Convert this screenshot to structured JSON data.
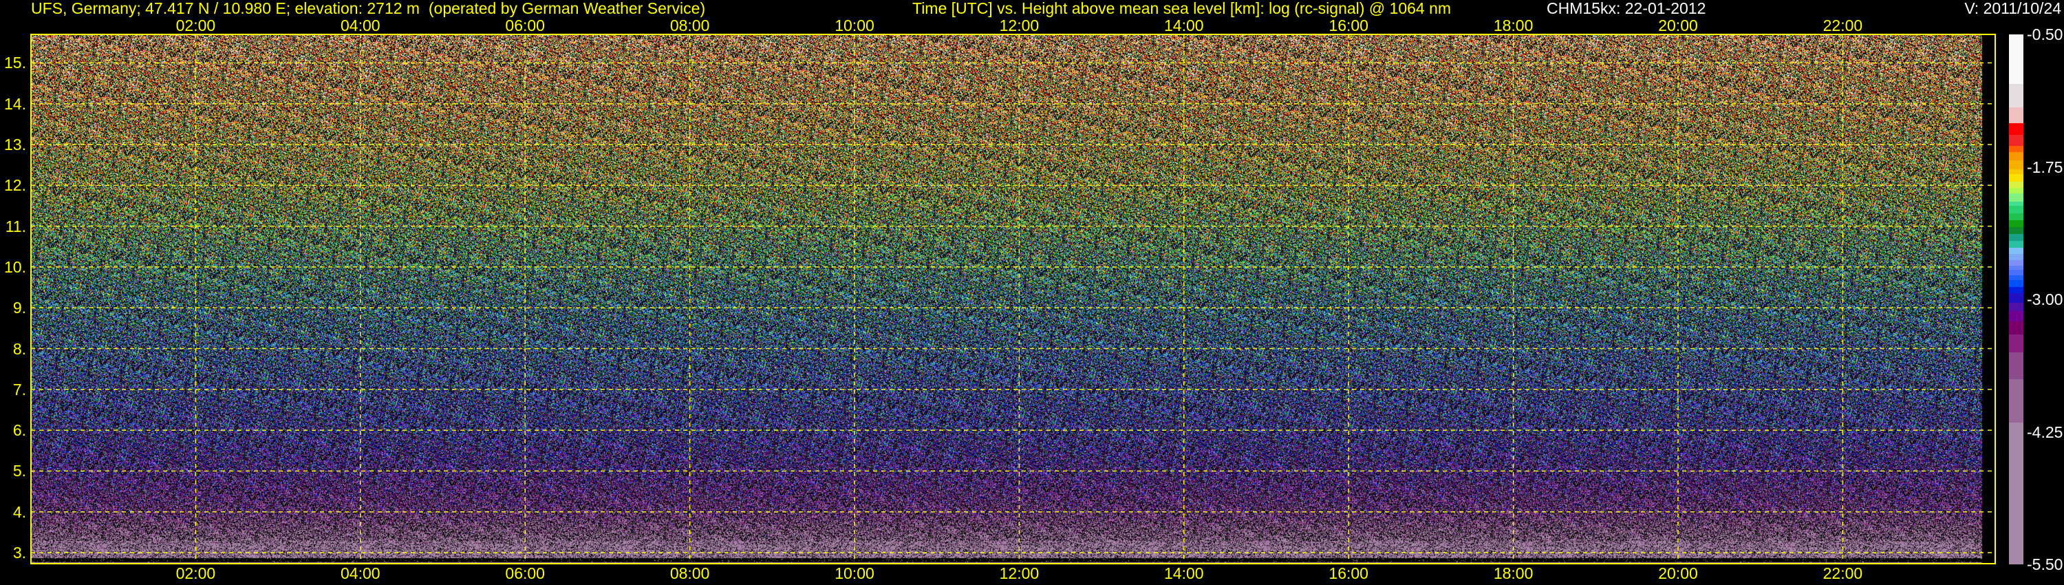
{
  "header": {
    "station": "UFS, Germany; 47.417 N / 10.980 E; elevation: 2712 m  (operated by German Weather Service)",
    "title": "Time [UTC] vs. Height above mean sea level [km]: log (rc-signal) @ 1064 nm",
    "instrument": "CHM15kx: 22-01-2012",
    "version": "V: 2011/10/24"
  },
  "colors": {
    "axis": "#ffff00",
    "background": "#000000",
    "label_secondary": "#ffffff"
  },
  "chart_data": {
    "type": "heatmap",
    "title": "Time [UTC] vs. Height above mean sea level [km]: log (rc-signal) @ 1064 nm",
    "xlabel": "Time [UTC]",
    "ylabel": "Height above mean sea level [km]",
    "xlim_hours": [
      0,
      23.85
    ],
    "ylim_km": [
      2.73,
      15.7
    ],
    "grid": true,
    "x_ticks": [
      "02:00",
      "04:00",
      "06:00",
      "08:00",
      "10:00",
      "12:00",
      "14:00",
      "16:00",
      "18:00",
      "20:00",
      "22:00"
    ],
    "x_tick_hours": [
      2,
      4,
      6,
      8,
      10,
      12,
      14,
      16,
      18,
      20,
      22
    ],
    "y_ticks": [
      "3.",
      "4.",
      "5.",
      "6.",
      "7.",
      "8.",
      "9.",
      "10.",
      "11.",
      "12.",
      "13.",
      "14.",
      "15."
    ],
    "y_tick_km": [
      3,
      4,
      5,
      6,
      7,
      8,
      9,
      10,
      11,
      12,
      13,
      14,
      15
    ],
    "colorbar": {
      "range": [
        -5.5,
        -0.5
      ],
      "tick_labels": [
        "-0.50",
        "-1.75",
        "-3.00",
        "-4.25",
        "-5.50"
      ],
      "tick_values": [
        -0.5,
        -1.75,
        -3.0,
        -4.25,
        -5.5
      ],
      "segments": [
        {
          "from": -0.5,
          "to": -0.97,
          "color": "#f8f8f8"
        },
        {
          "from": -0.97,
          "to": -1.19,
          "color": "#e6dede"
        },
        {
          "from": -1.19,
          "to": -1.34,
          "color": "#f0c0c0"
        },
        {
          "from": -1.34,
          "to": -1.45,
          "color": "#ff0000"
        },
        {
          "from": -1.45,
          "to": -1.55,
          "color": "#f02828"
        },
        {
          "from": -1.55,
          "to": -1.61,
          "color": "#ff6000"
        },
        {
          "from": -1.61,
          "to": -1.69,
          "color": "#f89800"
        },
        {
          "from": -1.69,
          "to": -1.77,
          "color": "#f8b000"
        },
        {
          "from": -1.77,
          "to": -1.82,
          "color": "#f8c800"
        },
        {
          "from": -1.82,
          "to": -1.89,
          "color": "#f8e000"
        },
        {
          "from": -1.89,
          "to": -1.95,
          "color": "#d8f040"
        },
        {
          "from": -1.95,
          "to": -2.0,
          "color": "#b0f850"
        },
        {
          "from": -2.0,
          "to": -2.08,
          "color": "#80f080"
        },
        {
          "from": -2.08,
          "to": -2.12,
          "color": "#40e090"
        },
        {
          "from": -2.12,
          "to": -2.19,
          "color": "#28d070"
        },
        {
          "from": -2.19,
          "to": -2.25,
          "color": "#20c050"
        },
        {
          "from": -2.25,
          "to": -2.32,
          "color": "#10a010"
        },
        {
          "from": -2.32,
          "to": -2.38,
          "color": "#108830"
        },
        {
          "from": -2.38,
          "to": -2.45,
          "color": "#18a088"
        },
        {
          "from": -2.45,
          "to": -2.51,
          "color": "#28c0a0"
        },
        {
          "from": -2.51,
          "to": -2.57,
          "color": "#80c0f8"
        },
        {
          "from": -2.57,
          "to": -2.63,
          "color": "#80a8f8"
        },
        {
          "from": -2.63,
          "to": -2.68,
          "color": "#8090f8"
        },
        {
          "from": -2.68,
          "to": -2.72,
          "color": "#6080f8"
        },
        {
          "from": -2.72,
          "to": -2.77,
          "color": "#4870f8"
        },
        {
          "from": -2.77,
          "to": -2.82,
          "color": "#2060f8"
        },
        {
          "from": -2.82,
          "to": -2.88,
          "color": "#0050f8"
        },
        {
          "from": -2.88,
          "to": -2.94,
          "color": "#0020e0"
        },
        {
          "from": -2.94,
          "to": -3.03,
          "color": "#2010c0"
        },
        {
          "from": -3.03,
          "to": -3.11,
          "color": "#5010a8"
        },
        {
          "from": -3.11,
          "to": -3.21,
          "color": "#700090"
        },
        {
          "from": -3.21,
          "to": -3.33,
          "color": "#780068"
        },
        {
          "from": -3.33,
          "to": -3.5,
          "color": "#882080"
        },
        {
          "from": -3.5,
          "to": -3.75,
          "color": "#8c4c8c"
        },
        {
          "from": -3.75,
          "to": -4.16,
          "color": "#986898"
        },
        {
          "from": -4.16,
          "to": -5.5,
          "color": "#a888a8"
        }
      ]
    },
    "mean_profile": {
      "height_km": [
        2.9,
        3.2,
        4,
        5,
        6,
        7,
        8,
        9,
        10,
        11,
        12,
        13,
        14,
        15,
        15.7
      ],
      "log_signal": [
        -4.6,
        -4.4,
        -3.6,
        -3.2,
        -2.95,
        -2.8,
        -2.65,
        -2.5,
        -2.3,
        -2.1,
        -1.9,
        -1.75,
        -1.6,
        -1.5,
        -1.4
      ]
    }
  }
}
